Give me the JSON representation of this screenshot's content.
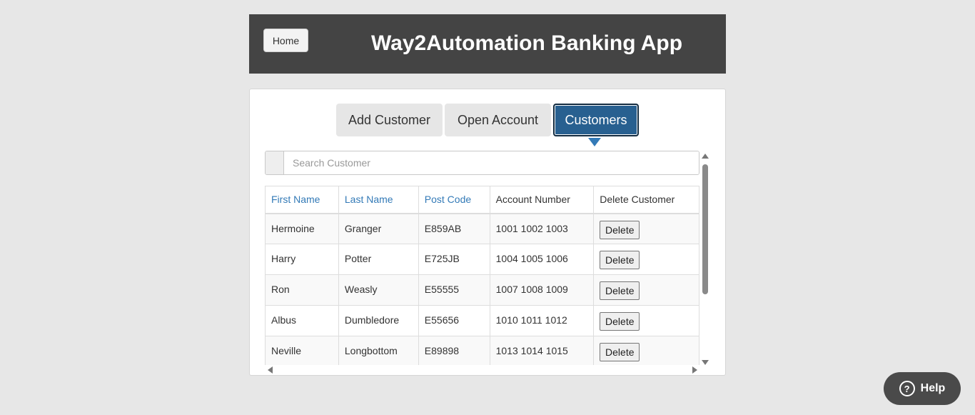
{
  "header": {
    "home_label": "Home",
    "title": "Way2Automation Banking App"
  },
  "tabs": {
    "add_customer": "Add Customer",
    "open_account": "Open Account",
    "customers": "Customers",
    "active": "customers"
  },
  "search": {
    "placeholder": "Search Customer",
    "value": ""
  },
  "table": {
    "columns": [
      "First Name",
      "Last Name",
      "Post Code",
      "Account Number",
      "Delete Customer"
    ],
    "delete_label": "Delete",
    "rows": [
      {
        "first": "Hermoine",
        "last": "Granger",
        "post": "E859AB",
        "accounts": "1001 1002 1003"
      },
      {
        "first": "Harry",
        "last": "Potter",
        "post": "E725JB",
        "accounts": "1004 1005 1006"
      },
      {
        "first": "Ron",
        "last": "Weasly",
        "post": "E55555",
        "accounts": "1007 1008 1009"
      },
      {
        "first": "Albus",
        "last": "Dumbledore",
        "post": "E55656",
        "accounts": "1010 1011 1012"
      },
      {
        "first": "Neville",
        "last": "Longbottom",
        "post": "E89898",
        "accounts": "1013 1014 1015"
      }
    ]
  },
  "help": {
    "label": "Help",
    "icon": "question-circle-icon"
  },
  "colors": {
    "header_bg": "#444444",
    "page_bg": "#e7e7e7",
    "active_tab": "#286090",
    "link": "#337ab7"
  }
}
